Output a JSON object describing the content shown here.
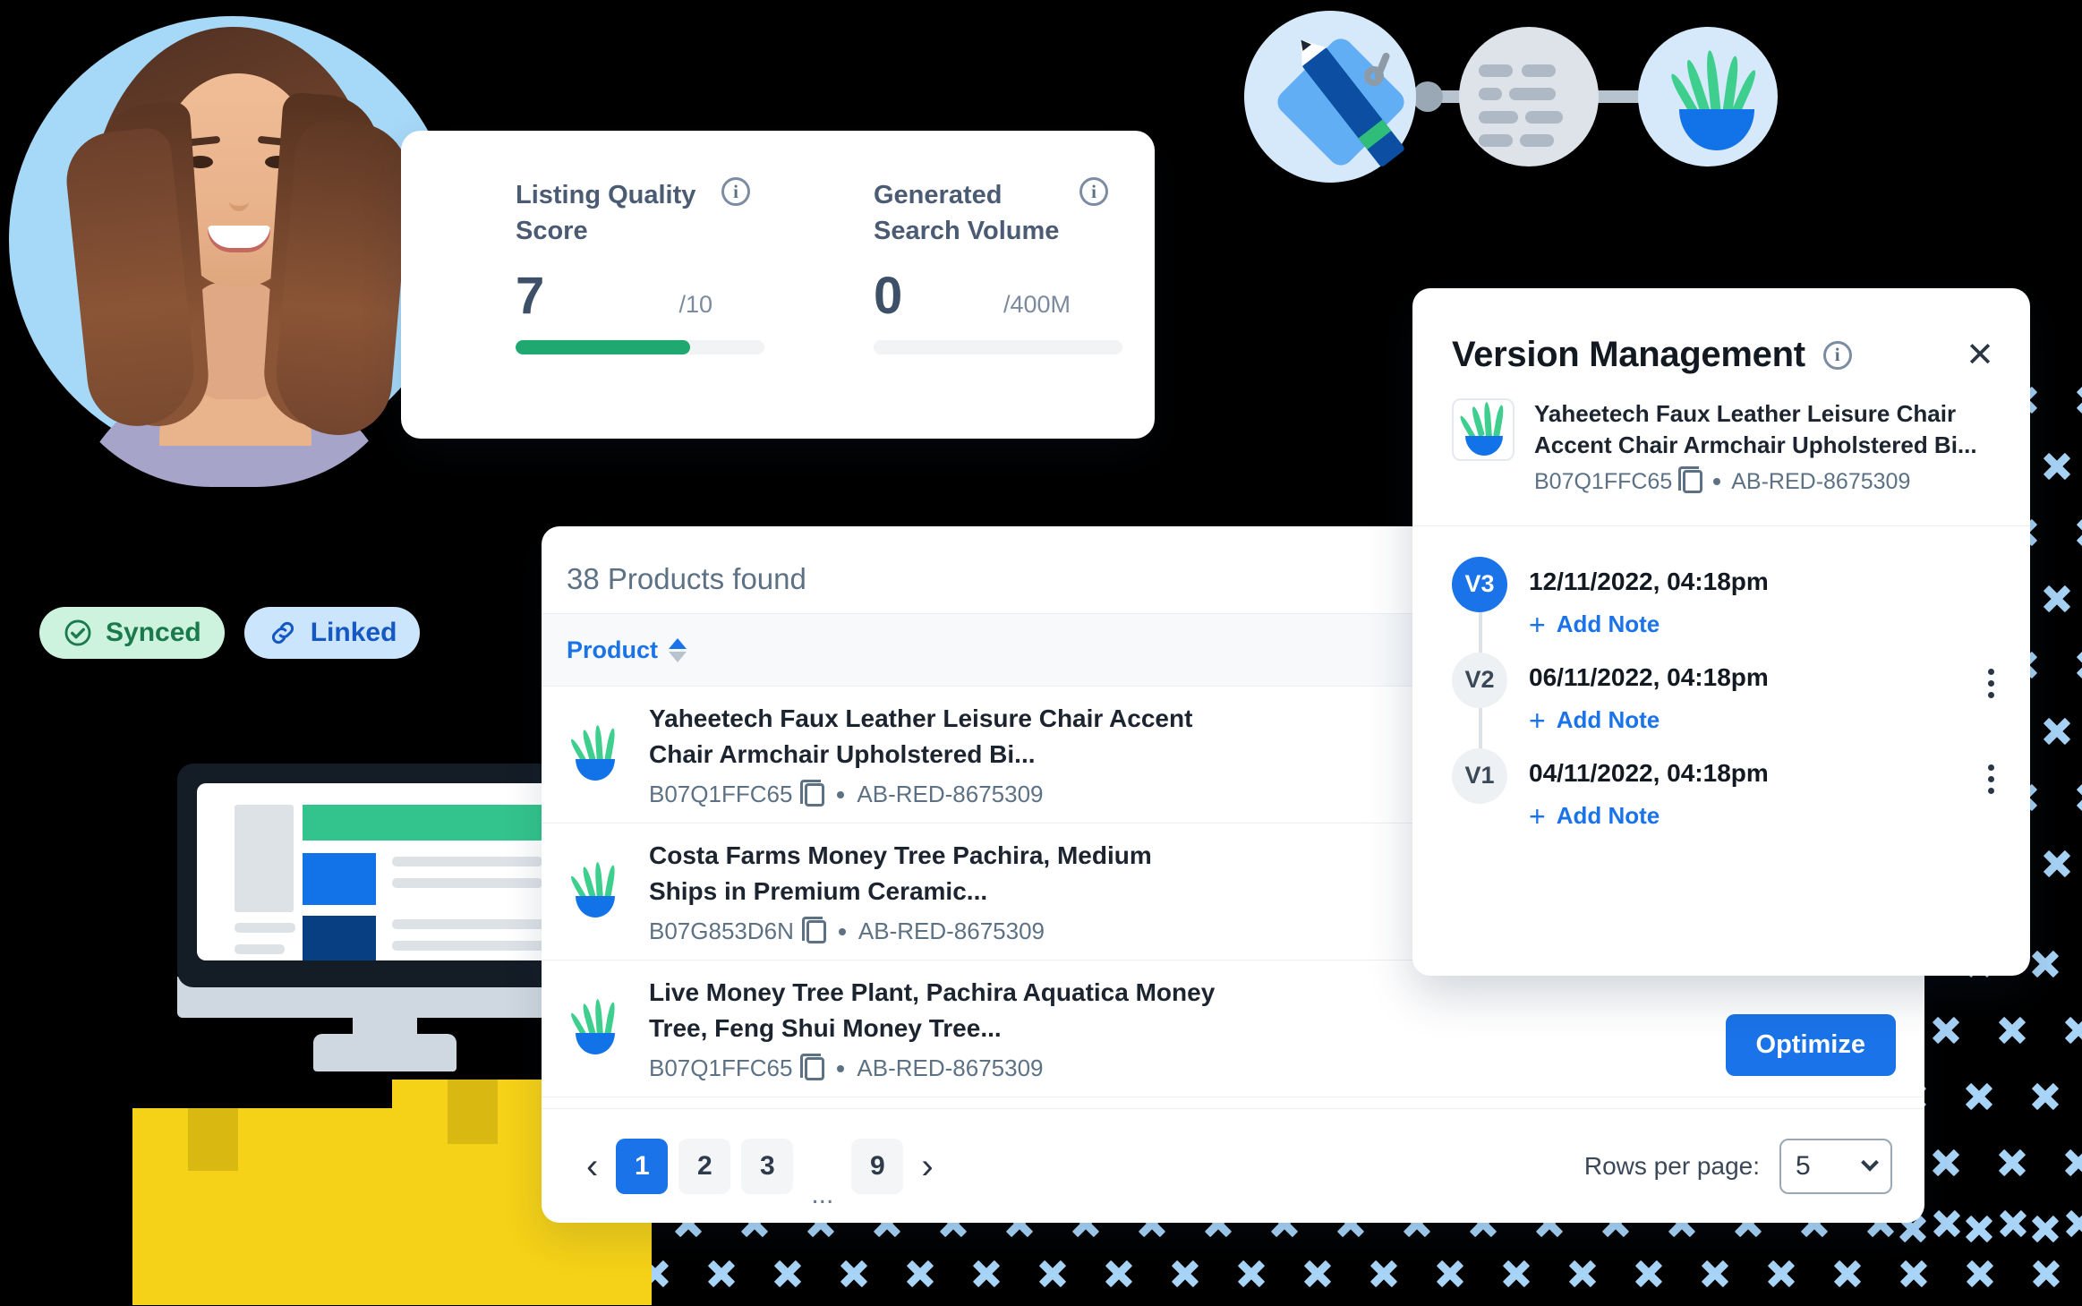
{
  "score_card": {
    "metrics": [
      {
        "title": "Listing Quality Score",
        "value": "7",
        "max": "/10",
        "progress_pct": 70,
        "info_icon": "info-icon",
        "bar_color": "#1fa971"
      },
      {
        "title": "Generated Search Volume",
        "value": "0",
        "max": "/400M",
        "progress_pct": 0,
        "info_icon": "info-icon",
        "bar_color": "#1fa971"
      }
    ]
  },
  "badges": [
    {
      "label": "Synced",
      "icon": "check-circle-icon",
      "bg": "#cdf3de",
      "fg": "#1b7a4b"
    },
    {
      "label": "Linked",
      "icon": "link-icon",
      "bg": "#cbe5fd",
      "fg": "#1558c4"
    }
  ],
  "products": {
    "found_label": "38 Products found",
    "columns": [
      {
        "label": "Product",
        "sortable": true,
        "sort_icon": "sort-arrows-icon"
      }
    ],
    "rows": [
      {
        "title": "Yaheetech Faux Leather Leisure Chair Accent Chair Armchair Upholstered Bi...",
        "asin": "B07Q1FFC65",
        "sku": "AB-RED-8675309",
        "copy_icon": "copy-icon",
        "thumb_icon": "plant-icon"
      },
      {
        "title": "Costa Farms Money Tree Pachira, Medium Ships in Premium Ceramic...",
        "asin": "B07G853D6N",
        "sku": "AB-RED-8675309",
        "copy_icon": "copy-icon",
        "thumb_icon": "plant-icon"
      },
      {
        "title": "Live Money Tree Plant, Pachira Aquatica Money Tree, Feng Shui Money Tree...",
        "asin": "B07Q1FFC65",
        "sku": "AB-RED-8675309",
        "copy_icon": "copy-icon",
        "thumb_icon": "plant-icon"
      }
    ],
    "optimize_label": "Optimize",
    "pagination": {
      "prev_icon": "chevron-left-icon",
      "next_icon": "chevron-right-icon",
      "pages": [
        "1",
        "2",
        "3"
      ],
      "ellipsis": "...",
      "last_page": "9",
      "active_page": "1",
      "rows_label": "Rows per page:",
      "rows_value": "5",
      "rows_chevron": "chevron-down-icon"
    }
  },
  "version_panel": {
    "title": "Version Management",
    "info_icon": "info-icon",
    "close_icon": "close-icon",
    "product": {
      "title": "Yaheetech Faux Leather Leisure Chair Accent Chair Armchair Upholstered Bi...",
      "asin": "B07Q1FFC65",
      "sku": "AB-RED-8675309",
      "copy_icon": "copy-icon",
      "thumb_icon": "plant-icon"
    },
    "add_note_label": "Add Note",
    "add_note_icon": "plus-icon",
    "kebab_icon": "more-vertical-icon",
    "versions": [
      {
        "tag": "V3",
        "date": "12/11/2022, 04:18pm",
        "current": true,
        "has_menu": false
      },
      {
        "tag": "V2",
        "date": "06/11/2022, 04:18pm",
        "current": false,
        "has_menu": true
      },
      {
        "tag": "V1",
        "date": "04/11/2022, 04:18pm",
        "current": false,
        "has_menu": true
      }
    ]
  },
  "decorations": {
    "avatar_icon": "user-avatar-photo",
    "monitor_icon": "desktop-monitor-illustration",
    "boxes_icon": "shipping-boxes-illustration",
    "flow_icons": [
      "tag-pencil-icon",
      "document-lines-icon",
      "plant-icon"
    ],
    "pattern_icon": "x-dot-pattern",
    "accent_blue": "#1a73e8",
    "accent_green": "#1fa971",
    "pattern_color": "#a8d4f7"
  }
}
